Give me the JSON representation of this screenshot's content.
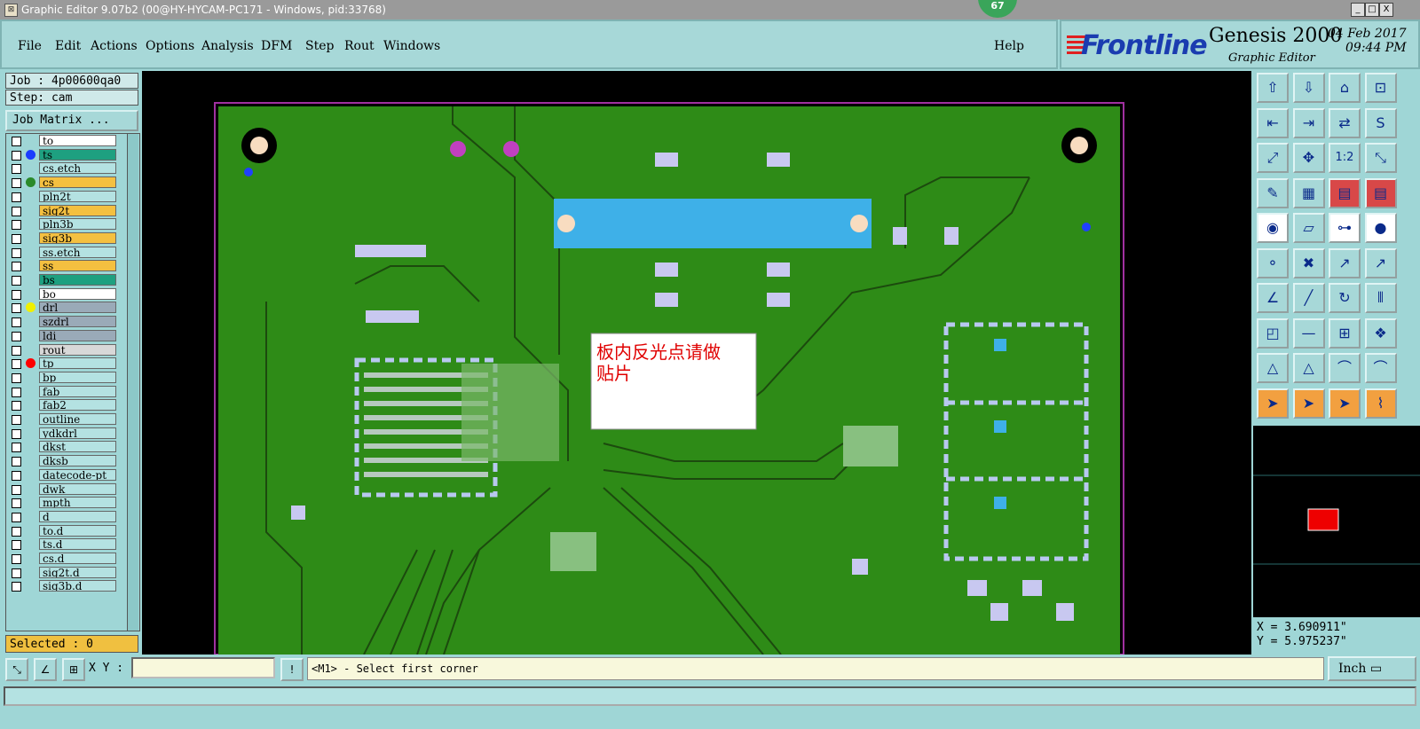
{
  "window": {
    "title": "Graphic Editor 9.07b2 (00@HY-HYCAM-PC171 - Windows, pid:33768)",
    "badge": "67",
    "controls": [
      "_",
      "□",
      "X"
    ]
  },
  "menu": {
    "items": [
      "File",
      "Edit",
      "Actions",
      "Options",
      "Analysis",
      "DFM",
      "Step",
      "Rout",
      "Windows"
    ],
    "help": "Help"
  },
  "branding": {
    "logo": "Frontline",
    "product": "Genesis 2000",
    "subtitle": "Graphic Editor",
    "date": "04 Feb 2017",
    "time": "09:44 PM"
  },
  "left": {
    "job": "Job : 4p00600qa0",
    "step": "Step: cam",
    "job_matrix": "Job Matrix ...",
    "selected": "Selected : 0"
  },
  "layers": [
    {
      "name": "to",
      "color": "#ffffff",
      "dot": ""
    },
    {
      "name": "ts",
      "color": "#1ea080",
      "dot": "#1a3cff"
    },
    {
      "name": "cs.etch",
      "color": "#b4e2e2",
      "dot": ""
    },
    {
      "name": "cs",
      "color": "#f4c040",
      "dot": "#2a8a2a"
    },
    {
      "name": "pln2t",
      "color": "#b4e2e2",
      "dot": ""
    },
    {
      "name": "sig2t",
      "color": "#f4c040",
      "dot": ""
    },
    {
      "name": "pln3b",
      "color": "#b4e2e2",
      "dot": ""
    },
    {
      "name": "sig3b",
      "color": "#f4c040",
      "dot": ""
    },
    {
      "name": "ss.etch",
      "color": "#b4e2e2",
      "dot": ""
    },
    {
      "name": "ss",
      "color": "#f4c040",
      "dot": ""
    },
    {
      "name": "bs",
      "color": "#1ea080",
      "dot": ""
    },
    {
      "name": "bo",
      "color": "#ffffff",
      "dot": ""
    },
    {
      "name": "drl",
      "color": "#9aaab8",
      "dot": "#f0f000"
    },
    {
      "name": "szdrl",
      "color": "#9aaab8",
      "dot": ""
    },
    {
      "name": "ldi",
      "color": "#9aaab8",
      "dot": ""
    },
    {
      "name": "rout",
      "color": "#d8d8d8",
      "dot": ""
    },
    {
      "name": "tp",
      "color": "#b4e2e2",
      "dot": "#ff0000"
    },
    {
      "name": "bp",
      "color": "#b4e2e2",
      "dot": ""
    },
    {
      "name": "fab",
      "color": "#b4e2e2",
      "dot": ""
    },
    {
      "name": "fab2",
      "color": "#b4e2e2",
      "dot": ""
    },
    {
      "name": "outline",
      "color": "#b4e2e2",
      "dot": ""
    },
    {
      "name": "ydkdrl",
      "color": "#b4e2e2",
      "dot": ""
    },
    {
      "name": "dkst",
      "color": "#b4e2e2",
      "dot": ""
    },
    {
      "name": "dksb",
      "color": "#b4e2e2",
      "dot": ""
    },
    {
      "name": "datecode-pt",
      "color": "#b4e2e2",
      "dot": ""
    },
    {
      "name": "dwk",
      "color": "#b4e2e2",
      "dot": ""
    },
    {
      "name": "mpth",
      "color": "#b4e2e2",
      "dot": ""
    },
    {
      "name": "d",
      "color": "#b4e2e2",
      "dot": ""
    },
    {
      "name": "to.d",
      "color": "#b4e2e2",
      "dot": ""
    },
    {
      "name": "ts.d",
      "color": "#b4e2e2",
      "dot": ""
    },
    {
      "name": "cs.d",
      "color": "#b4e2e2",
      "dot": ""
    },
    {
      "name": "sig2t.d",
      "color": "#b4e2e2",
      "dot": ""
    },
    {
      "name": "sig3b.d",
      "color": "#b4e2e2",
      "dot": ""
    }
  ],
  "canvas": {
    "annotation": "板内反光点请做贴片",
    "board_color": "#2e8b17",
    "trace_color": "#1c4a0e"
  },
  "tools": {
    "chip_label": "1:2"
  },
  "coords": {
    "x": "X =  3.690911\"",
    "y": "Y =  5.975237\""
  },
  "bottom": {
    "xy_label": "X Y :",
    "status": "<M1> - Select first corner",
    "units": "Inch"
  }
}
